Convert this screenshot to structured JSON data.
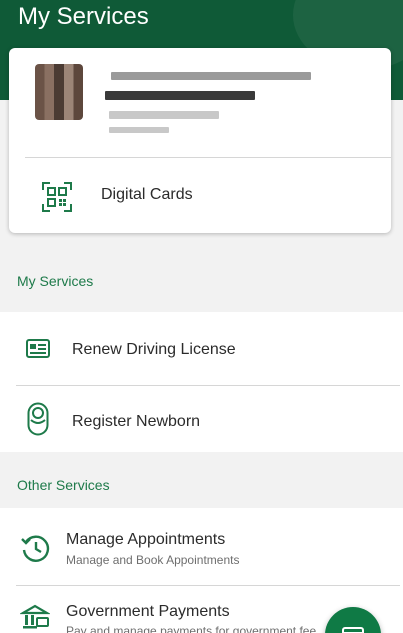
{
  "header": {
    "title": "My Services"
  },
  "profile_card": {
    "digital_cards_label": "Digital Cards",
    "digital_cards_icon": "qr-code-icon"
  },
  "my_services": {
    "section_title": "My Services",
    "items": [
      {
        "label": "Renew Driving License",
        "icon": "id-card-icon"
      },
      {
        "label": "Register Newborn",
        "icon": "baby-icon"
      }
    ]
  },
  "other_services": {
    "section_title": "Other Services",
    "items": [
      {
        "label": "Manage Appointments",
        "sub": "Manage and Book Appointments",
        "icon": "history-clock-icon"
      },
      {
        "label": "Government Payments",
        "sub": "Pay and manage payments for government fee",
        "icon": "bank-payment-icon"
      }
    ]
  },
  "fab": {
    "icon": "wallet-card-icon"
  },
  "colors": {
    "brand_green": "#0f5a37",
    "accent_green": "#1e7a4a"
  }
}
